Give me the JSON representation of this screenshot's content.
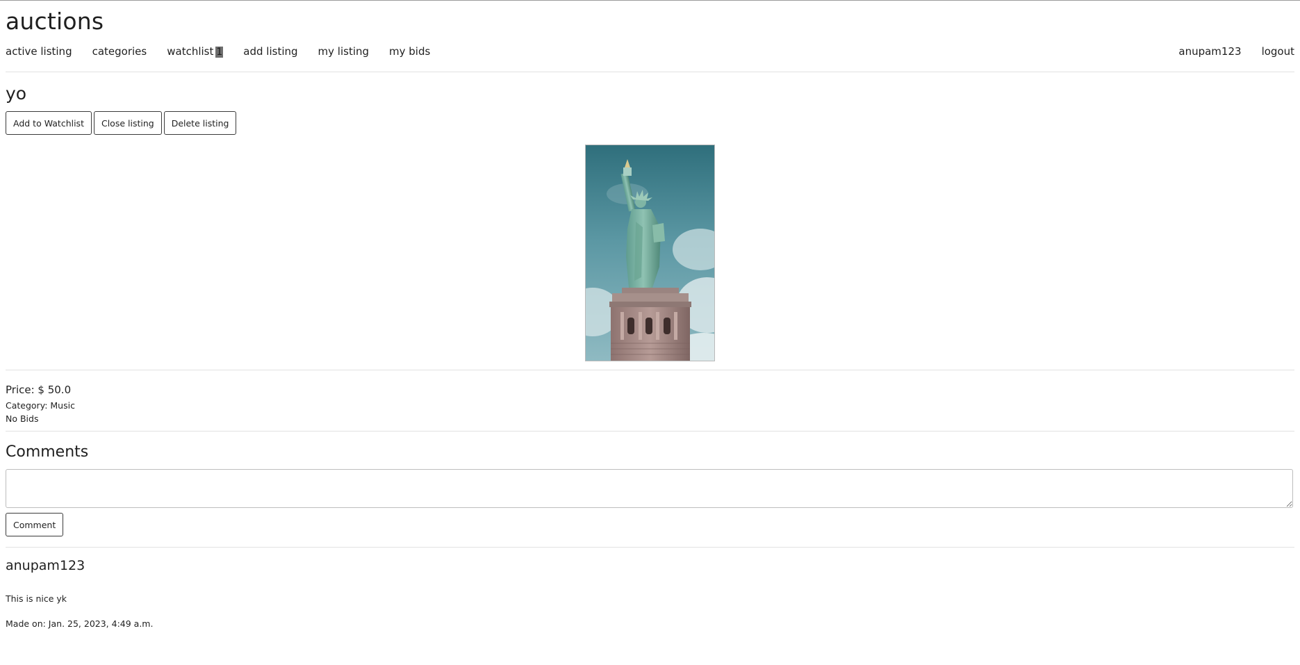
{
  "site": {
    "title": "auctions"
  },
  "nav": {
    "left": [
      {
        "label": "active listing"
      },
      {
        "label": "categories"
      },
      {
        "label": "watchlist",
        "badge": "1"
      },
      {
        "label": "add listing"
      },
      {
        "label": "my listing"
      },
      {
        "label": "my bids"
      }
    ],
    "right": [
      {
        "label": "anupam123"
      },
      {
        "label": "logout"
      }
    ]
  },
  "listing": {
    "title": "yo",
    "buttons": {
      "watchlist": "Add to Watchlist",
      "close": "Close listing",
      "delete": "Delete listing"
    },
    "price": "Price: $ 50.0",
    "category": "Category: Music",
    "bids": "No Bids"
  },
  "comments": {
    "heading": "Comments",
    "input_value": "",
    "submit_label": "Comment",
    "items": [
      {
        "author": "anupam123",
        "text": "This is nice yk",
        "date": "Made on: Jan. 25, 2023, 4:49 a.m."
      }
    ]
  },
  "colors": {
    "text": "#1f1f1f",
    "divider": "#e2e2e2",
    "badge_bg": "#6e6e6e"
  }
}
